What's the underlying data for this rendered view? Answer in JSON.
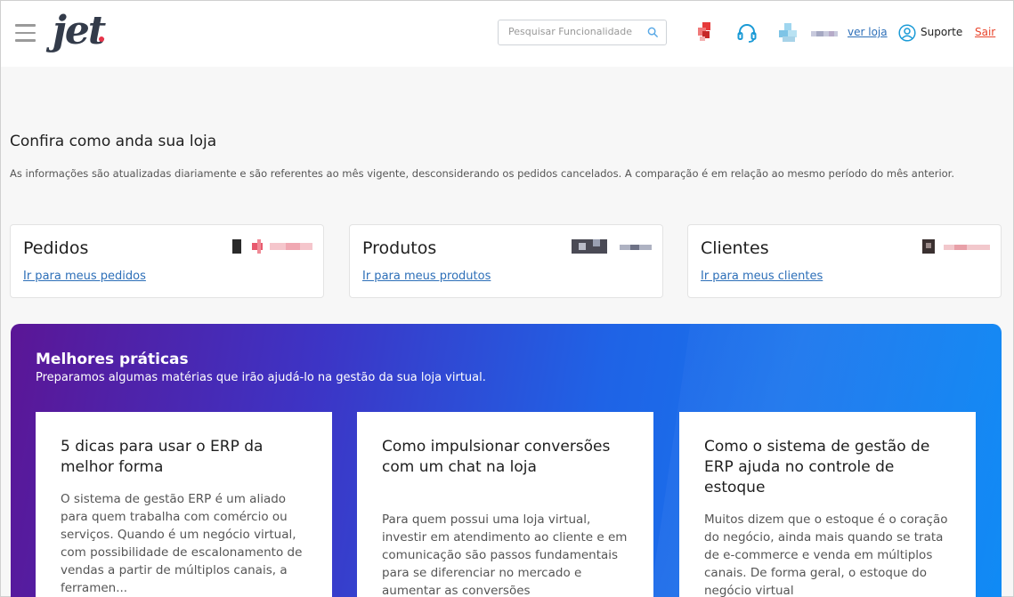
{
  "header": {
    "logo_text": "jet",
    "search": {
      "placeholder": "Pesquisar Funcionalidade",
      "value": ""
    },
    "ver_loja_label": "ver loja",
    "suporte_label": "Suporte",
    "sair_label": "Sair",
    "icons": [
      "menu-icon",
      "search-icon",
      "notification-icon",
      "headset-icon",
      "user-icon"
    ],
    "colors": {
      "accent": "#e8344a",
      "link": "#2d6fb8",
      "logout": "#e8452c"
    }
  },
  "overview": {
    "title": "Confira como anda sua loja",
    "description": "As informações são atualizadas diariamente e são referentes ao mês vigente, desconsiderando os pedidos cancelados. A comparação é em relação ao mesmo período do mês anterior."
  },
  "stat_cards": [
    {
      "title": "Pedidos",
      "link": "Ir para meus pedidos"
    },
    {
      "title": "Produtos",
      "link": "Ir para meus produtos"
    },
    {
      "title": "Clientes",
      "link": "Ir para meus clientes"
    }
  ],
  "best_practices": {
    "title": "Melhores práticas",
    "subtitle": "Preparamos algumas matérias que irão ajudá-lo na gestão da sua loja virtual.",
    "gradient_colors": [
      "#5b1696",
      "#1f63e6",
      "#0f8af5"
    ],
    "articles": [
      {
        "title": "5 dicas para usar o ERP da melhor forma",
        "text": "O sistema de gestão ERP é um aliado para quem trabalha com comércio ou serviços. Quando é um negócio virtual, com possibilidade de escalonamento de vendas a partir de múltiplos canais, a ferramen..."
      },
      {
        "title": "Como impulsionar conversões com um chat na loja",
        "text": "Para quem possui uma loja virtual, investir em atendimento ao cliente e em comunicação são passos fundamentais para  se diferenciar no mercado e aumentar as conversões"
      },
      {
        "title": "Como o sistema de gestão de ERP ajuda no controle de estoque",
        "text": "Muitos dizem que o estoque é o coração do negócio, ainda mais quando se trata de e-commerce e venda em múltiplos canais. De forma geral, o estoque do negócio virtual"
      }
    ]
  }
}
